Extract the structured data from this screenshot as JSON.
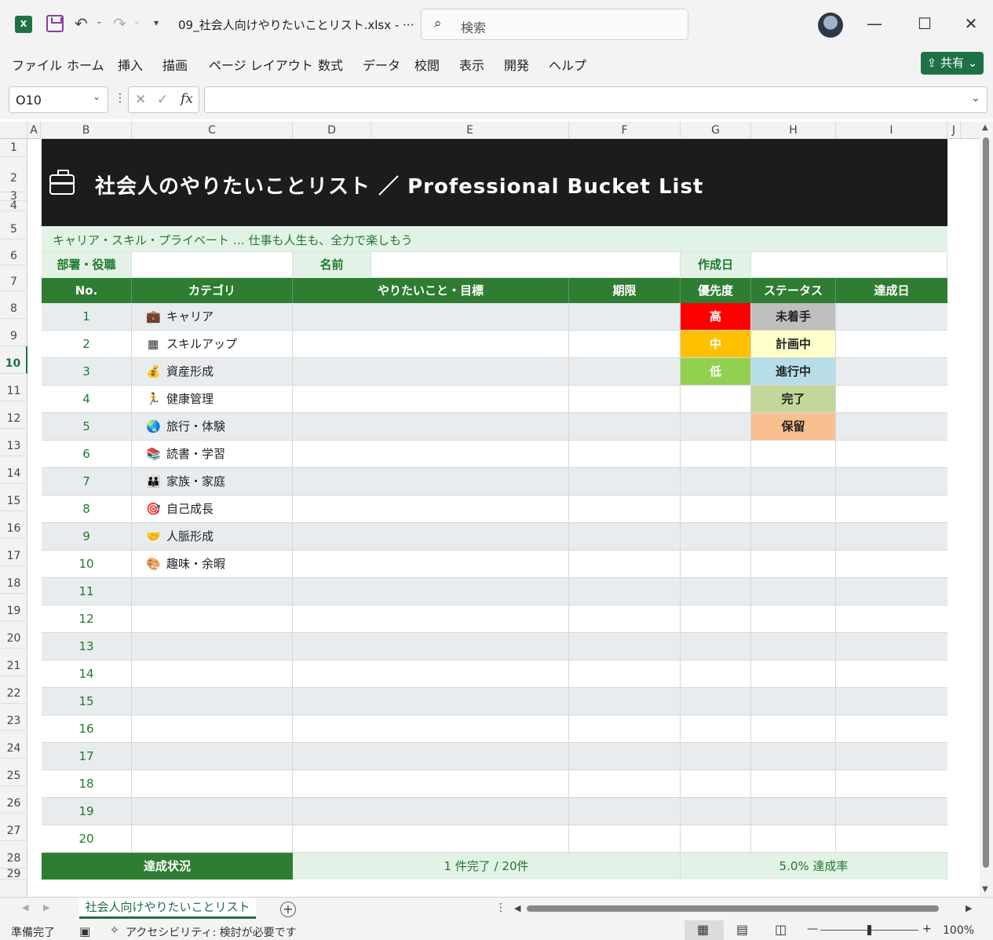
{
  "window": {
    "app_icon": "X",
    "filename": "09_社会人向けやりたいことリスト.xlsx  -  ···",
    "search_placeholder": "検索",
    "minimize": "—",
    "maximize": "☐",
    "close": "✕"
  },
  "ribbon": {
    "tabs": [
      "ファイル",
      "ホーム",
      "挿入",
      "描画",
      "ページ レイアウト",
      "数式",
      "データ",
      "校閲",
      "表示",
      "開発",
      "ヘルプ"
    ],
    "share_label": "共有"
  },
  "formula_bar": {
    "name_box": "O10",
    "cancel_glyph": "✕",
    "enter_glyph": "✓",
    "fx_label": "fx",
    "formula": ""
  },
  "columns": [
    "A",
    "B",
    "C",
    "D",
    "E",
    "F",
    "G",
    "H",
    "I",
    "J"
  ],
  "rows": [
    "1",
    "2",
    "3",
    "4",
    "5",
    "6",
    "7",
    "8",
    "9",
    "10",
    "11",
    "12",
    "13",
    "14",
    "15",
    "16",
    "17",
    "18",
    "19",
    "20",
    "21",
    "22",
    "23",
    "24",
    "25",
    "26",
    "27",
    "28",
    "29"
  ],
  "selected_row": "10",
  "sheet": {
    "title": "社会人のやりたいことリスト  ／  Professional Bucket List",
    "subtitle": "キャリア・スキル・プライベート … 仕事も人生も、全力で楽しもう",
    "info": {
      "dept_label": "部署・役職",
      "name_label": "名前",
      "date_label": "作成日"
    },
    "headers": {
      "no": "No.",
      "category": "カテゴリ",
      "goal": "やりたいこと・目標",
      "deadline": "期限",
      "priority": "優先度",
      "status": "ステータス",
      "done_date": "達成日"
    },
    "items": [
      {
        "no": "1",
        "icon": "💼",
        "category": "キャリア",
        "priority": "高",
        "status": "未着手"
      },
      {
        "no": "2",
        "icon": "▦",
        "category": "スキルアップ",
        "priority": "中",
        "status": "計画中"
      },
      {
        "no": "3",
        "icon": "💰",
        "category": "資産形成",
        "priority": "低",
        "status": "進行中"
      },
      {
        "no": "4",
        "icon": "🏃",
        "category": "健康管理",
        "priority": "",
        "status": "完了"
      },
      {
        "no": "5",
        "icon": "🌏",
        "category": "旅行・体験",
        "priority": "",
        "status": "保留"
      },
      {
        "no": "6",
        "icon": "📚",
        "category": "読書・学習",
        "priority": "",
        "status": ""
      },
      {
        "no": "7",
        "icon": "👪",
        "category": "家族・家庭",
        "priority": "",
        "status": ""
      },
      {
        "no": "8",
        "icon": "🎯",
        "category": "自己成長",
        "priority": "",
        "status": ""
      },
      {
        "no": "9",
        "icon": "🤝",
        "category": "人脈形成",
        "priority": "",
        "status": ""
      },
      {
        "no": "10",
        "icon": "🎨",
        "category": "趣味・余暇",
        "priority": "",
        "status": ""
      },
      {
        "no": "11",
        "icon": "",
        "category": "",
        "priority": "",
        "status": ""
      },
      {
        "no": "12",
        "icon": "",
        "category": "",
        "priority": "",
        "status": ""
      },
      {
        "no": "13",
        "icon": "",
        "category": "",
        "priority": "",
        "status": ""
      },
      {
        "no": "14",
        "icon": "",
        "category": "",
        "priority": "",
        "status": ""
      },
      {
        "no": "15",
        "icon": "",
        "category": "",
        "priority": "",
        "status": ""
      },
      {
        "no": "16",
        "icon": "",
        "category": "",
        "priority": "",
        "status": ""
      },
      {
        "no": "17",
        "icon": "",
        "category": "",
        "priority": "",
        "status": ""
      },
      {
        "no": "18",
        "icon": "",
        "category": "",
        "priority": "",
        "status": ""
      },
      {
        "no": "19",
        "icon": "",
        "category": "",
        "priority": "",
        "status": ""
      },
      {
        "no": "20",
        "icon": "",
        "category": "",
        "priority": "",
        "status": ""
      }
    ],
    "priority_colors": {
      "高": "#ff0000",
      "中": "#ffc000",
      "低": "#92d050"
    },
    "status_colors": {
      "未着手": "#bfbfbf",
      "計画中": "#ffffcc",
      "進行中": "#b7dee8",
      "完了": "#c4d79b",
      "保留": "#fabf8f"
    },
    "footer": {
      "label": "達成状況",
      "count": "1 件完了 / 20件",
      "rate": "5.0% 達成率"
    }
  },
  "sheet_tab": "社会人向けやりたいことリスト",
  "status_bar": {
    "ready": "準備完了",
    "accessibility": "アクセシビリティ: 検討が必要です",
    "zoom": "100%",
    "zoom_out": "—",
    "zoom_in": "+"
  },
  "colors": {
    "brand": "#1e7145",
    "header_green": "#2e7d32",
    "banner": "#1c1c1c"
  }
}
